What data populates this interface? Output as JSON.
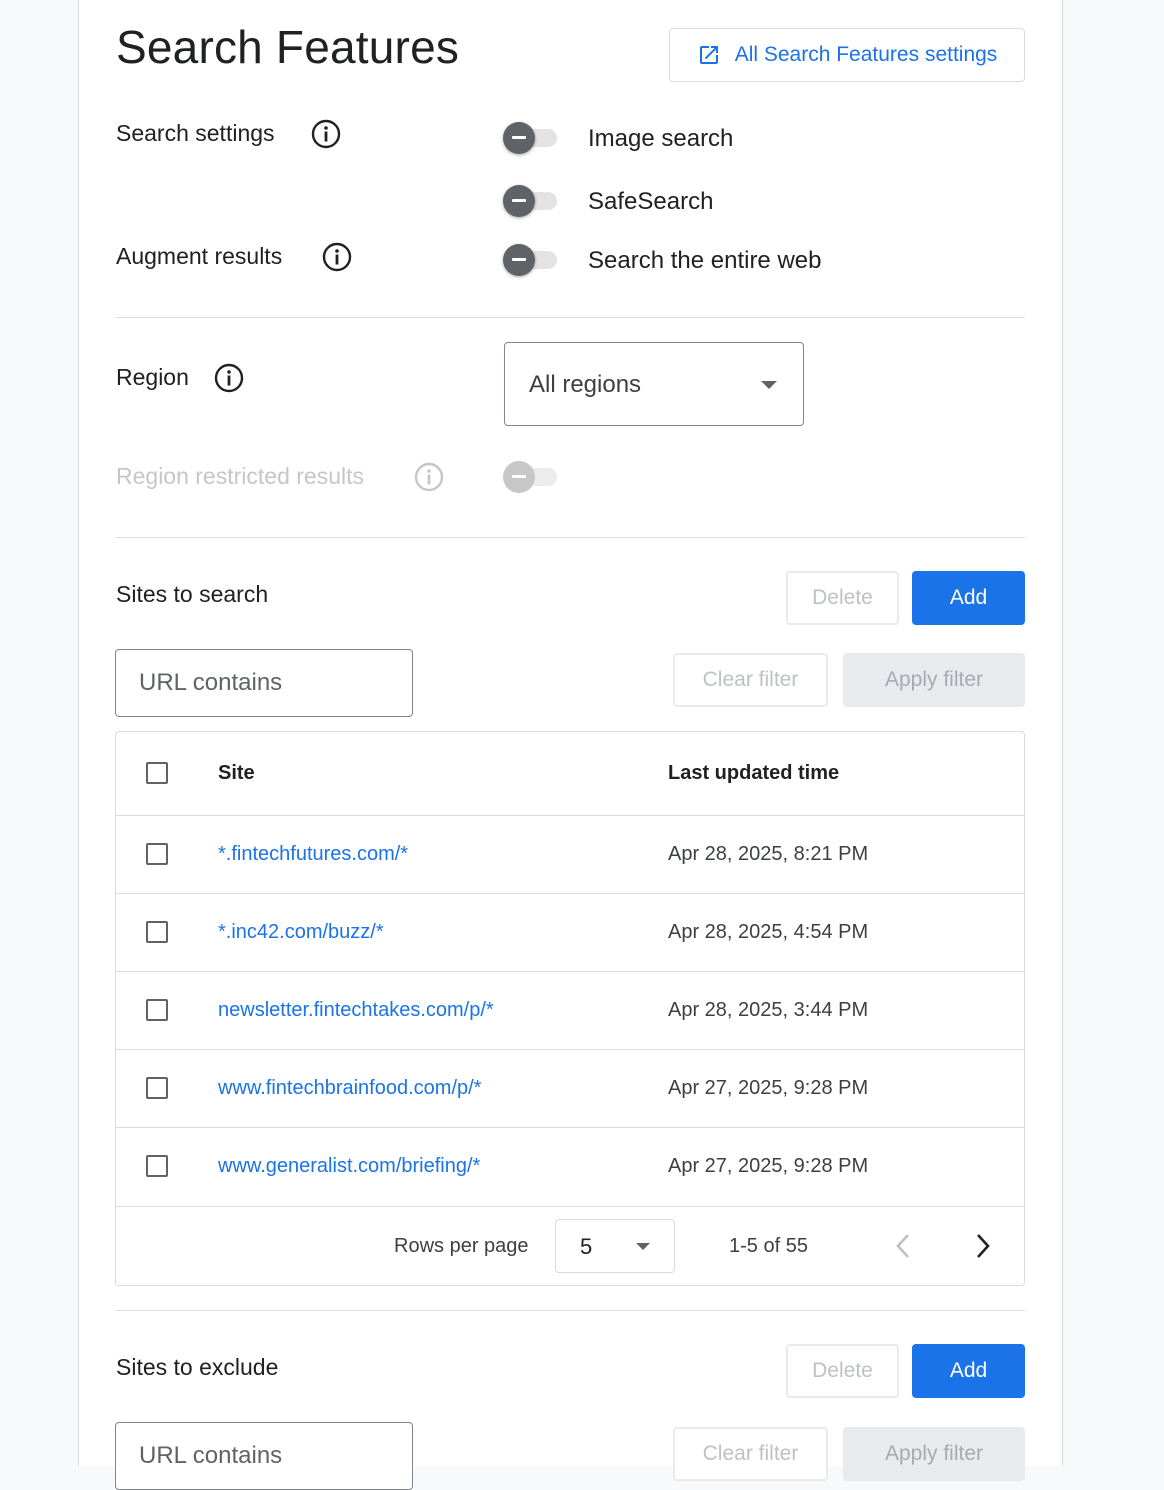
{
  "header": {
    "title": "Search Features",
    "settings_button": "All Search Features settings",
    "settings_icon": "open-in-new-icon"
  },
  "search_settings": {
    "label": "Search settings",
    "toggles": [
      {
        "label": "Image search",
        "state": "indeterminate"
      },
      {
        "label": "SafeSearch",
        "state": "indeterminate"
      }
    ]
  },
  "augment_results": {
    "label": "Augment results",
    "toggle": {
      "label": "Search the entire web",
      "state": "indeterminate"
    }
  },
  "region": {
    "label": "Region",
    "selected": "All regions",
    "restricted_label": "Region restricted results"
  },
  "sites_to_search": {
    "title": "Sites to search",
    "delete_label": "Delete",
    "add_label": "Add",
    "filter_placeholder": "URL contains",
    "clear_filter_label": "Clear filter",
    "apply_filter_label": "Apply filter",
    "columns": [
      "Site",
      "Last updated time"
    ],
    "rows": [
      {
        "site": "*.fintechfutures.com/*",
        "updated": "Apr 28, 2025, 8:21 PM"
      },
      {
        "site": "*.inc42.com/buzz/*",
        "updated": "Apr 28, 2025, 4:54 PM"
      },
      {
        "site": "newsletter.fintechtakes.com/p/*",
        "updated": "Apr 28, 2025, 3:44 PM"
      },
      {
        "site": "www.fintechbrainfood.com/p/*",
        "updated": "Apr 27, 2025, 9:28 PM"
      },
      {
        "site": "www.generalist.com/briefing/*",
        "updated": "Apr 27, 2025, 9:28 PM"
      }
    ],
    "pagination": {
      "rows_per_page_label": "Rows per page",
      "rows_per_page": "5",
      "range": "1-5 of 55"
    }
  },
  "sites_to_exclude": {
    "title": "Sites to exclude",
    "delete_label": "Delete",
    "add_label": "Add",
    "filter_placeholder": "URL contains",
    "clear_filter_label": "Clear filter",
    "apply_filter_label": "Apply filter"
  },
  "colors": {
    "accent": "#1a73e8",
    "toggle_thumb": "#5f6368",
    "divider": "#dadce0"
  }
}
